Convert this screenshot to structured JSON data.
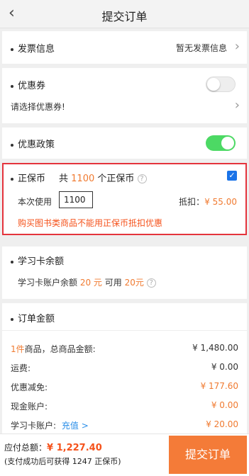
{
  "header": {
    "back_glyph": "‹",
    "title": "提交订单"
  },
  "invoice": {
    "label": "发票信息",
    "value": "暂无发票信息"
  },
  "coupon": {
    "label": "优惠券",
    "hint": "请选择优惠券!"
  },
  "policy": {
    "label": "优惠政策"
  },
  "zhengbao": {
    "label": "正保币",
    "total_prefix": "共",
    "total_amount": "1100",
    "total_suffix": "个正保币",
    "use_label": "本次使用",
    "use_value": "1100",
    "deduct_label": "抵扣：",
    "deduct_value": "¥ 55.00",
    "warning": "购买图书类商品不能用正保币抵扣优惠"
  },
  "study_card": {
    "label": "学习卡余额",
    "balance_text_1": "学习卡账户余额",
    "balance_amount": "20 元",
    "available_text": "可用",
    "available_amount": "20元"
  },
  "order": {
    "label": "订单金额",
    "count": "1件",
    "count_suffix": "商品，总商品金额:",
    "total_value": "¥ 1,480.00",
    "rows": [
      {
        "label": "运费:",
        "value": "¥ 0.00",
        "color": "#333333"
      },
      {
        "label": "优惠减免:",
        "value": "¥ 177.60",
        "color": "#f07a30"
      },
      {
        "label": "现金账户:",
        "value": "¥ 0.00",
        "color": "#f07a30"
      },
      {
        "label": "学习卡账户:",
        "link": "充值 >",
        "value": "¥ 20.00",
        "color": "#f07a30"
      }
    ]
  },
  "footer": {
    "total_label": "应付总额：",
    "total_value": "¥ 1,227.40",
    "note": "(支付成功后可获得 1247 正保币)",
    "submit_label": "提交订单"
  },
  "colors": {
    "accent": "#f47b38",
    "highlight_border": "#e4343c",
    "toggle_on": "#4cd964",
    "link": "#2a8ee8"
  }
}
